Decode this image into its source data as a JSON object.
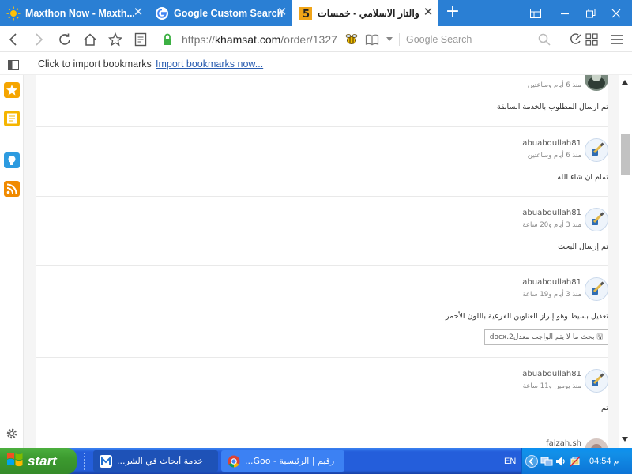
{
  "browser": {
    "tabs": [
      {
        "title": "Maxthon Now - Maxth...",
        "icon": "sun-icon",
        "active": false
      },
      {
        "title": "Google Custom Search",
        "icon": "google-icon",
        "active": false
      },
      {
        "title": "والتار الاسلامي - خمسات",
        "icon": "khamsat-icon",
        "active": true
      }
    ],
    "address": {
      "scheme": "https://",
      "domain": "khamsat.com",
      "path": "/order/1327"
    },
    "search_placeholder": "Google Search",
    "bookmarks": {
      "import_text": "Click to import bookmarks",
      "import_link": "Import bookmarks now..."
    },
    "accent_color": "#2a7fd4"
  },
  "comments": [
    {
      "name": "",
      "time": "منذ 6 أيام وساعتين",
      "text": "تم ارسال المطلوب بالخدمة السابقة",
      "avatar": "photo"
    },
    {
      "name": "abuabdullah81",
      "time": "منذ 6 أيام وساعتين",
      "text": "تمام ان شاء الله",
      "avatar": "pen-icon"
    },
    {
      "name": "abuabdullah81",
      "time": "منذ 3 أيام و20 ساعة",
      "text": "تم إرسال البحث",
      "avatar": "pen-icon"
    },
    {
      "name": "abuabdullah81",
      "time": "منذ 3 أيام و19 ساعة",
      "text": "تعديل بسيط وهو إبراز العناوين الفرعية باللون الأحمر",
      "attachment": "بحث ما لا يتم الواجب معدل2.docx",
      "avatar": "pen-icon"
    },
    {
      "name": "abuabdullah81",
      "time": "منذ يومين و11 ساعة",
      "text": "تم",
      "avatar": "pen-icon"
    },
    {
      "name": "faizah.sh",
      "time": "",
      "text": "",
      "avatar": "photo"
    }
  ],
  "taskbar": {
    "start_label": "start",
    "items": [
      {
        "label": "خدمة أبحاث في الشر...",
        "icon": "maxthon-icon",
        "active": true
      },
      {
        "label": "رقيم | الرئيسية - Goo...",
        "icon": "chrome-icon",
        "active": false
      }
    ],
    "language": "EN",
    "time": "04:54 م"
  }
}
